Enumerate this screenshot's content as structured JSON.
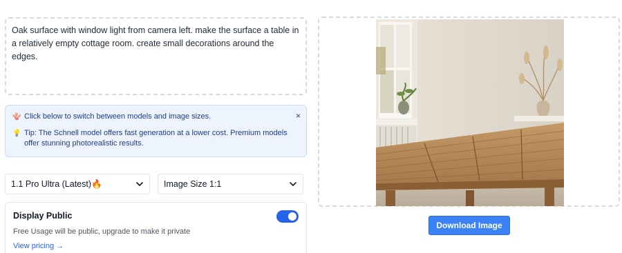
{
  "prompt": {
    "text": "Oak surface with window light from camera left. make the surface a table in a relatively empty cottage room. create small decorations around the edges."
  },
  "info": {
    "line1_emoji": "🪸",
    "line1": "Click below to switch between models and image sizes.",
    "line2_emoji": "💡",
    "line2": "Tip: The Schnell model offers fast generation at a lower cost. Premium models offer stunning photorealistic results.",
    "close": "×"
  },
  "selects": {
    "model": "1.1 Pro Ultra (Latest)🔥",
    "size": "Image Size 1:1"
  },
  "public": {
    "title": "Display Public",
    "subtitle": "Free Usage will be public, upgrade to make it private",
    "link": "View pricing →",
    "toggle_on": true
  },
  "output": {
    "download_label": "Download Image"
  },
  "colors": {
    "accent": "#2563eb",
    "button": "#3b82f6",
    "info_bg": "#eef4fd"
  }
}
